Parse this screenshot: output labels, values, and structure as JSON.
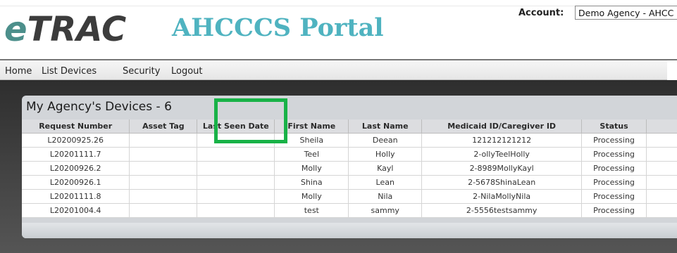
{
  "header": {
    "logo_text": "TRAC",
    "logo_e": "e",
    "portal_title": "AHCCCS Portal",
    "account_label": "Account:",
    "account_value": "Demo Agency - AHCC"
  },
  "nav": {
    "items": [
      "Home",
      "List Devices",
      "Security",
      "Logout"
    ]
  },
  "panel": {
    "title": "My Agency's Devices - 6"
  },
  "table": {
    "columns": [
      "Request Number",
      "Asset Tag",
      "Last Seen Date",
      "First Name",
      "Last Name",
      "Medicaid ID/Caregiver ID",
      "Status"
    ],
    "rows": [
      [
        "L20200925.26",
        "",
        "",
        "Sheila",
        "Deean",
        "121212121212",
        "Processing"
      ],
      [
        "L20201111.7",
        "",
        "",
        "Teel",
        "Holly",
        "2-ollyTeelHolly",
        "Processing"
      ],
      [
        "L20200926.2",
        "",
        "",
        "Molly",
        "Kayl",
        "2-8989MollyKayl",
        "Processing"
      ],
      [
        "L20200926.1",
        "",
        "",
        "Shina",
        "Lean",
        "2-5678ShinaLean",
        "Processing"
      ],
      [
        "L20201111.8",
        "",
        "",
        "Molly",
        "Nila",
        "2-NilaMollyNila",
        "Processing"
      ],
      [
        "L20201004.4",
        "",
        "",
        "test",
        "sammy",
        "2-5556testsammy",
        "Processing"
      ]
    ]
  },
  "colors": {
    "accent_title": "#4fb3c0",
    "highlight": "#18b247"
  }
}
